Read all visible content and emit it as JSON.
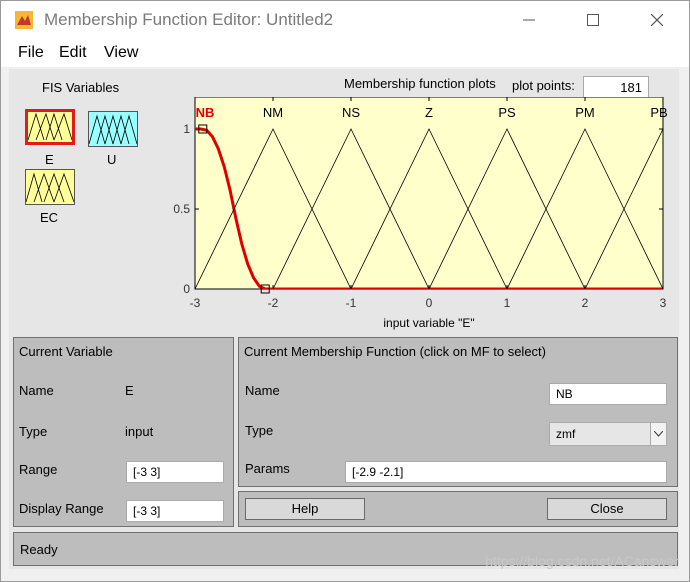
{
  "window": {
    "title": "Membership Function Editor: Untitled2"
  },
  "menu": [
    "File",
    "Edit",
    "View"
  ],
  "fis_variables": {
    "label": "FIS Variables",
    "items": [
      {
        "name": "E",
        "color": "#ffff99",
        "selected": true
      },
      {
        "name": "U",
        "color": "#99ffff",
        "selected": false
      },
      {
        "name": "EC",
        "color": "#ffff99",
        "selected": false
      }
    ]
  },
  "plot": {
    "title": "Membership function plots",
    "plot_points_label": "plot points:",
    "plot_points": "181",
    "xlabel": "input variable \"E\"",
    "background": "#ffffcc",
    "selected_color": "#dd0000"
  },
  "chart_data": {
    "type": "line",
    "xlim": [
      -3,
      3
    ],
    "ylim": [
      0,
      1
    ],
    "xticks": [
      "-3",
      "-2",
      "-1",
      "0",
      "1",
      "2",
      "3"
    ],
    "yticks": [
      "0",
      "0.5",
      "1"
    ],
    "xlabel": "input variable \"E\"",
    "series": [
      {
        "name": "NB",
        "kind": "zmf",
        "params": [
          -2.9,
          -2.1
        ],
        "selected": true
      },
      {
        "name": "NM",
        "points": [
          [
            -3,
            0
          ],
          [
            -2,
            1
          ],
          [
            -1,
            0
          ]
        ]
      },
      {
        "name": "NS",
        "points": [
          [
            -2,
            0
          ],
          [
            -1,
            1
          ],
          [
            0,
            0
          ]
        ]
      },
      {
        "name": "Z",
        "points": [
          [
            -1,
            0
          ],
          [
            0,
            1
          ],
          [
            1,
            0
          ]
        ]
      },
      {
        "name": "PS",
        "points": [
          [
            0,
            0
          ],
          [
            1,
            1
          ],
          [
            2,
            0
          ]
        ]
      },
      {
        "name": "PM",
        "points": [
          [
            1,
            0
          ],
          [
            2,
            1
          ],
          [
            3,
            0
          ]
        ]
      },
      {
        "name": "PB",
        "points": [
          [
            2,
            0
          ],
          [
            3,
            1
          ],
          [
            4,
            0
          ]
        ]
      }
    ]
  },
  "current_variable": {
    "title": "Current Variable",
    "name_label": "Name",
    "name": "E",
    "type_label": "Type",
    "type": "input",
    "range_label": "Range",
    "range": "[-3 3]",
    "display_range_label": "Display Range",
    "display_range": "[-3 3]"
  },
  "current_mf": {
    "title": "Current Membership Function (click on MF to select)",
    "name_label": "Name",
    "name": "NB",
    "type_label": "Type",
    "type": "zmf",
    "params_label": "Params",
    "params": "[-2.9 -2.1]"
  },
  "buttons": {
    "help": "Help",
    "close": "Close"
  },
  "status": "Ready",
  "watermark": "https://blog.csdn.net/ACanswer"
}
